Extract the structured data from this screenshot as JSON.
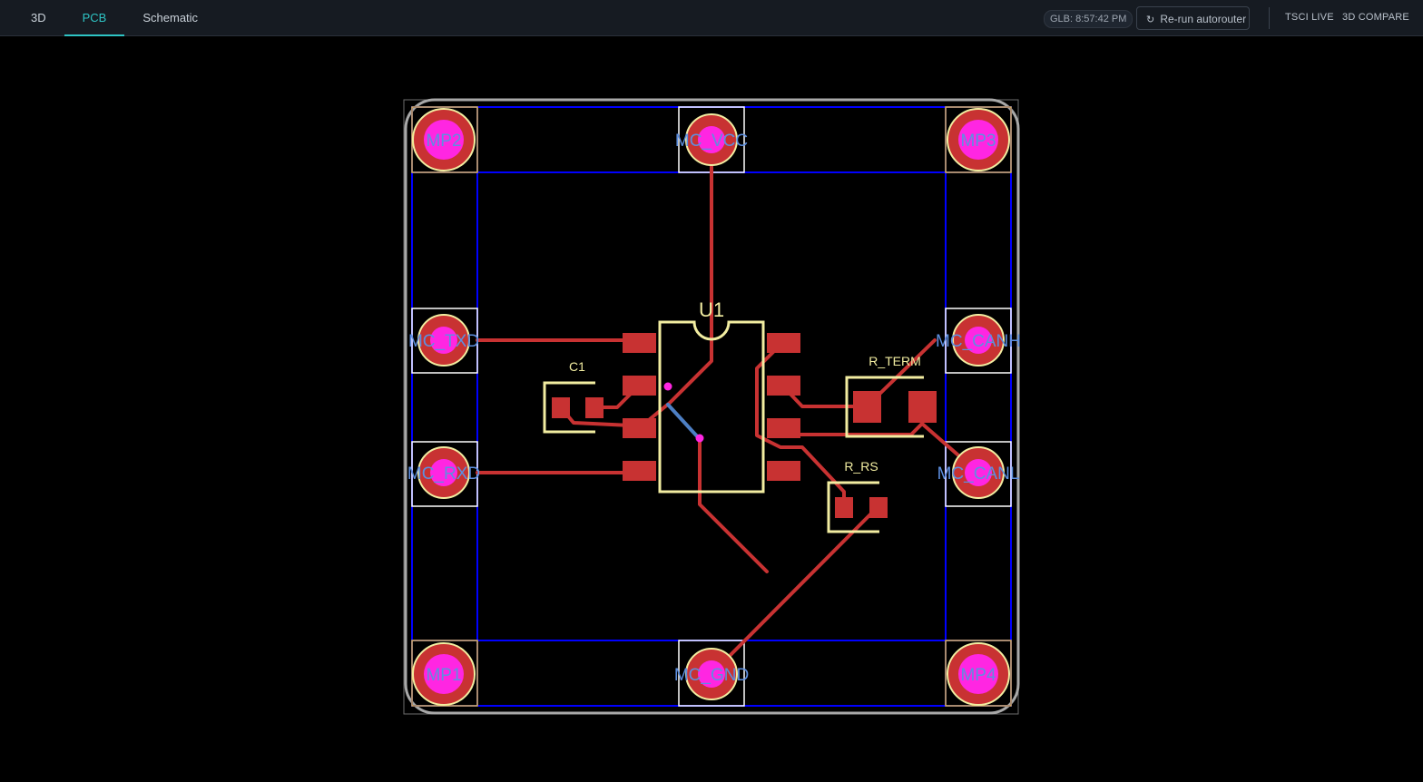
{
  "tabs": [
    {
      "label": "3D"
    },
    {
      "label": "PCB"
    },
    {
      "label": "Schematic"
    }
  ],
  "toolbar": {
    "build_time": "GLB: 8:57:42 PM",
    "rerun_label": "Re-run autorouter",
    "rerun_icon": "refresh-icon",
    "tsci_live": "TSCI LIVE",
    "compare_3d": "3D COMPARE"
  },
  "pcb": {
    "components": {
      "u1": "U1",
      "c1": "C1",
      "r_term": "R_TERM",
      "r_rs": "R_RS"
    },
    "mounting_holes": {
      "mp1": "MP1",
      "mp2": "MP2",
      "mp3": "MP3",
      "mp4": "MP4"
    },
    "connectors": {
      "vcc": "MC_VCC",
      "txd": "MC_TXD",
      "rxd": "MC_RXD",
      "canh": "MC_CANH",
      "canl": "MC_CANL",
      "gnd": "MC_GND"
    },
    "colors": {
      "background": "#000000",
      "copper_top": "#c83232",
      "copper_bottom": "#4d7fc4",
      "silkscreen": "#f2eda1",
      "board_outline": "#a8a8a8",
      "courtyard": "#0000ff",
      "hole": "#ff26e2",
      "pad_label": "#5d8fe0"
    }
  }
}
